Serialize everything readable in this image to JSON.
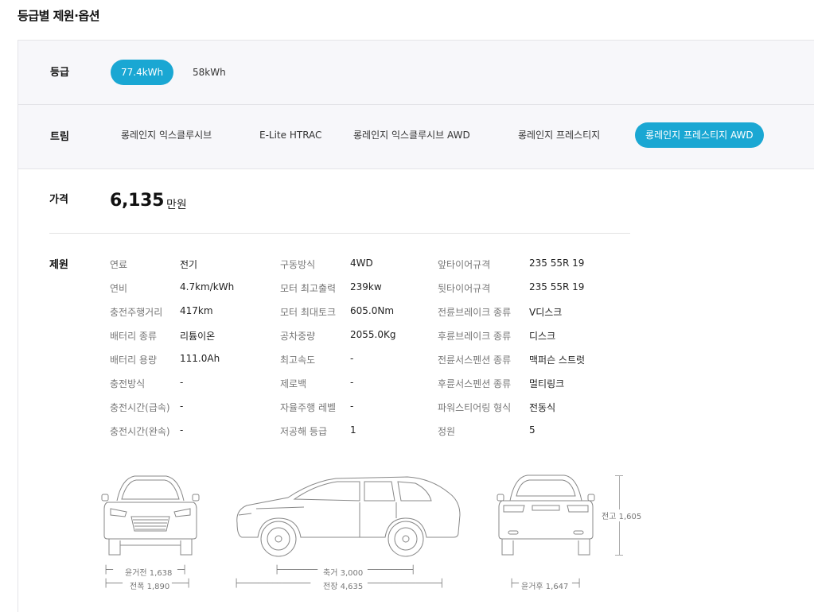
{
  "page_title": "등급별 제원·옵션",
  "grade": {
    "label": "등급",
    "options": [
      "77.4kWh",
      "58kWh"
    ],
    "selected": "77.4kWh"
  },
  "trim": {
    "label": "트림",
    "options": [
      "롱레인지 익스클루시브",
      "E-Lite HTRAC",
      "롱레인지 익스클루시브 AWD",
      "롱레인지 프레스티지",
      "롱레인지 프레스티지 AWD"
    ],
    "selected": "롱레인지 프레스티지 AWD"
  },
  "price": {
    "label": "가격",
    "value": "6,135",
    "unit": "만원"
  },
  "specs": {
    "label": "제원",
    "col1": [
      {
        "k": "연료",
        "v": "전기"
      },
      {
        "k": "연비",
        "v": "4.7km/kWh"
      },
      {
        "k": "충전주행거리",
        "v": "417km"
      },
      {
        "k": "배터리 종류",
        "v": "리튬이온"
      },
      {
        "k": "배터리 용량",
        "v": "111.0Ah"
      },
      {
        "k": "충전방식",
        "v": "-"
      },
      {
        "k": "충전시간(급속)",
        "v": "-"
      },
      {
        "k": "충전시간(완속)",
        "v": "-"
      }
    ],
    "col2": [
      {
        "k": "구동방식",
        "v": "4WD"
      },
      {
        "k": "모터 최고출력",
        "v": "239kw"
      },
      {
        "k": "모터 최대토크",
        "v": "605.0Nm"
      },
      {
        "k": "공차중량",
        "v": "2055.0Kg"
      },
      {
        "k": "최고속도",
        "v": "-"
      },
      {
        "k": "제로백",
        "v": "-"
      },
      {
        "k": "자율주행 레벨",
        "v": "-"
      },
      {
        "k": "저공해 등급",
        "v": "1"
      }
    ],
    "col3": [
      {
        "k": "앞타이어규격",
        "v": "235 55R 19"
      },
      {
        "k": "뒷타이어규격",
        "v": "235 55R 19"
      },
      {
        "k": "전륜브레이크 종류",
        "v": "V디스크"
      },
      {
        "k": "후륜브레이크 종류",
        "v": "디스크"
      },
      {
        "k": "전륜서스펜션 종류",
        "v": "맥퍼슨 스트럿"
      },
      {
        "k": "후륜서스펜션 종류",
        "v": "멀티링크"
      },
      {
        "k": "파워스티어링 형식",
        "v": "전동식"
      },
      {
        "k": "정원",
        "v": "5"
      }
    ]
  },
  "dimensions": {
    "front_track": "윤거전 1,638",
    "width": "전폭 1,890",
    "wheelbase": "축거 3,000",
    "length": "전장 4,635",
    "height": "전고 1,605",
    "rear_track": "윤거후 1,647"
  },
  "colors": {
    "accent": "#1aa7d3"
  }
}
